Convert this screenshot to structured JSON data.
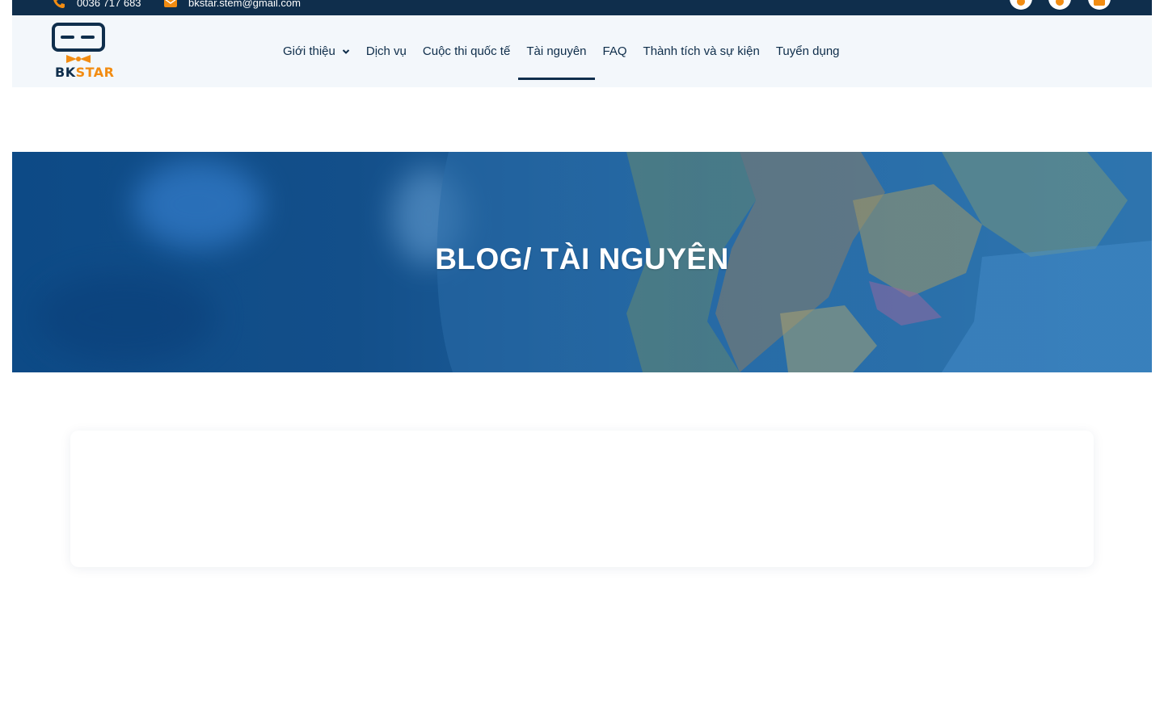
{
  "topbar": {
    "phone": "0036 717 683",
    "email": "bkstar.stem@gmail.com",
    "social": [
      "facebook-icon",
      "instagram-icon",
      "youtube-icon"
    ]
  },
  "brand": {
    "logo_bk": "BK",
    "logo_star": "STAR",
    "colors": {
      "navy": "#0f2e4c",
      "orange": "#f28c12",
      "header_bg": "#f3f7fb"
    }
  },
  "nav": {
    "items": [
      {
        "label": "Giới thiệu",
        "has_dropdown": true
      },
      {
        "label": "Dịch vụ"
      },
      {
        "label": "Cuộc thi quốc tế"
      },
      {
        "label": "Tài nguyên",
        "active": true
      },
      {
        "label": "FAQ"
      },
      {
        "label": "Thành tích và sự kiện"
      },
      {
        "label": "Tuyển dụng"
      }
    ]
  },
  "hero": {
    "title": "BLOG/ TÀI NGUYÊN"
  }
}
